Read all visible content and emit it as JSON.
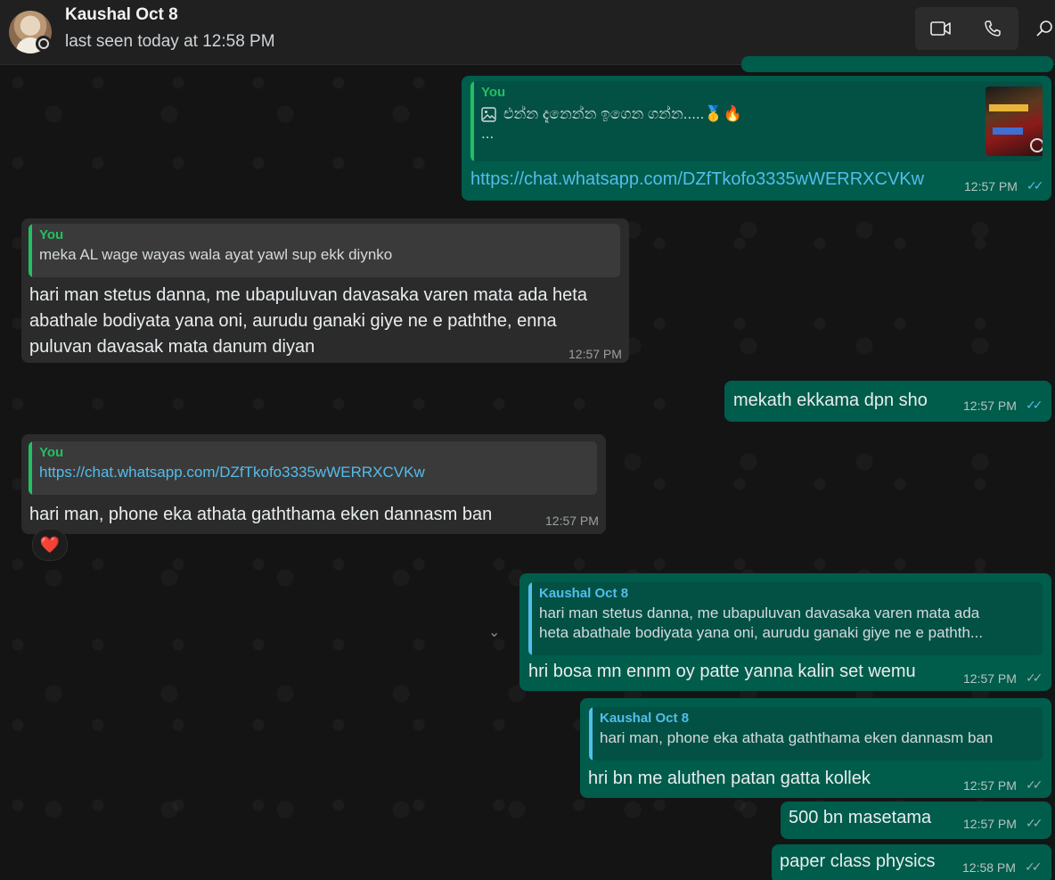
{
  "header": {
    "contact_name": "Kaushal Oct 8",
    "last_seen": "last seen today at 12:58 PM"
  },
  "messages": {
    "m1": {
      "quote_author": "You",
      "quote_line1": "එන්න දැනෙන්න ඉගෙන ගන්න.....🥇🔥",
      "quote_line2": "...",
      "link": "https://chat.whatsapp.com/DZfTkofo3335wWERRXCVKw",
      "time": "12:57 PM"
    },
    "m2": {
      "quote_author": "You",
      "quote_text": "meka AL wage wayas wala ayat yawl sup ekk diynko",
      "line1": "hari man stetus danna, me ubapuluvan davasaka varen mata ada heta",
      "line2": "abathale bodiyata yana oni, aurudu ganaki giye ne e paththe, enna",
      "line3": "puluvan davasak mata danum diyan",
      "time": "12:57 PM"
    },
    "m3": {
      "text": "mekath ekkama dpn sho",
      "time": "12:57 PM"
    },
    "m4": {
      "quote_author": "You",
      "quote_link": "https://chat.whatsapp.com/DZfTkofo3335wWERRXCVKw",
      "text": "hari man, phone eka athata gaththama eken dannasm ban",
      "time": "12:57 PM",
      "reaction": "❤️"
    },
    "m5": {
      "quote_author": "Kaushal Oct 8",
      "quote_line1": "hari man stetus danna, me ubapuluvan davasaka varen mata ada",
      "quote_line2": "heta abathale bodiyata yana oni, aurudu ganaki giye ne e pathth...",
      "text": "hri bosa mn ennm oy patte yanna kalin set wemu",
      "time": "12:57 PM"
    },
    "m6": {
      "quote_author": "Kaushal Oct 8",
      "quote_text": "hari man, phone eka athata gaththama eken dannasm ban",
      "text": "hri bn me aluthen patan gatta kollek",
      "time": "12:57 PM"
    },
    "m7": {
      "text": "500 bn masetama",
      "time": "12:57 PM"
    },
    "m8": {
      "text": "paper class physics",
      "time": "12:58 PM"
    }
  },
  "icons": {
    "tick": "✓✓",
    "image": "image-icon",
    "video": "video-call-icon",
    "voice": "voice-call-icon",
    "search": "search-icon"
  },
  "colors": {
    "outgoing_bubble": "#005c4b",
    "incoming_bubble": "#2b2b2b",
    "read_tick": "#53bdeb",
    "quote_you": "#21c063",
    "quote_contact": "#53bdeb"
  }
}
